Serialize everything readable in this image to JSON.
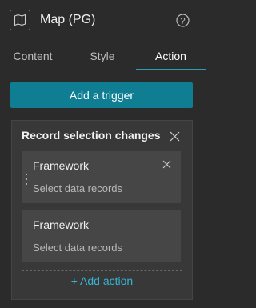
{
  "header": {
    "title": "Map (PG)",
    "icon": "map-icon",
    "help_icon": "help-icon"
  },
  "tabs": [
    {
      "label": "Content",
      "active": false
    },
    {
      "label": "Style",
      "active": false
    },
    {
      "label": "Action",
      "active": true
    }
  ],
  "add_trigger_label": "Add a trigger",
  "trigger": {
    "title": "Record selection changes",
    "actions": [
      {
        "name": "Framework",
        "description": "Select data records"
      },
      {
        "name": "Framework",
        "description": "Select data records"
      }
    ],
    "add_action_label": "+ Add action"
  },
  "colors": {
    "background": "#2b2b2b",
    "accent": "#0f7e93",
    "tab_underline": "#2d9cb6",
    "link": "#35b3d1"
  }
}
